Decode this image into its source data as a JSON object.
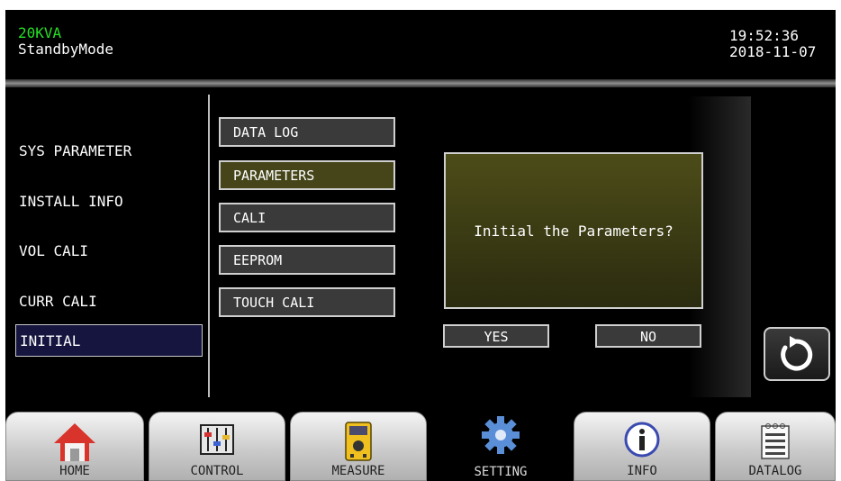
{
  "header": {
    "model": "20KVA",
    "mode": "StandbyMode",
    "time": "19:52:36",
    "date": "2018-11-07"
  },
  "left_menu": [
    "SYS PARAMETER",
    "INSTALL INFO",
    "VOL CALI",
    "CURR CALI",
    "INITIAL"
  ],
  "left_menu_active": "INITIAL",
  "mid_menu": [
    "DATA LOG",
    "PARAMETERS",
    "CALI",
    "EEPROM",
    "TOUCH CALI"
  ],
  "mid_menu_active": "PARAMETERS",
  "dialog": {
    "message": "Initial the Parameters?",
    "yes_label": "YES",
    "no_label": "NO"
  },
  "back_button": {
    "icon": "refresh-icon"
  },
  "nav_tabs": [
    {
      "label": "HOME",
      "icon": "home-icon"
    },
    {
      "label": "CONTROL",
      "icon": "sliders-icon"
    },
    {
      "label": "MEASURE",
      "icon": "multimeter-icon"
    },
    {
      "label": "SETTING",
      "icon": "gear-icon"
    },
    {
      "label": "INFO",
      "icon": "info-icon"
    },
    {
      "label": "DATALOG",
      "icon": "list-icon"
    }
  ],
  "nav_active": "SETTING"
}
